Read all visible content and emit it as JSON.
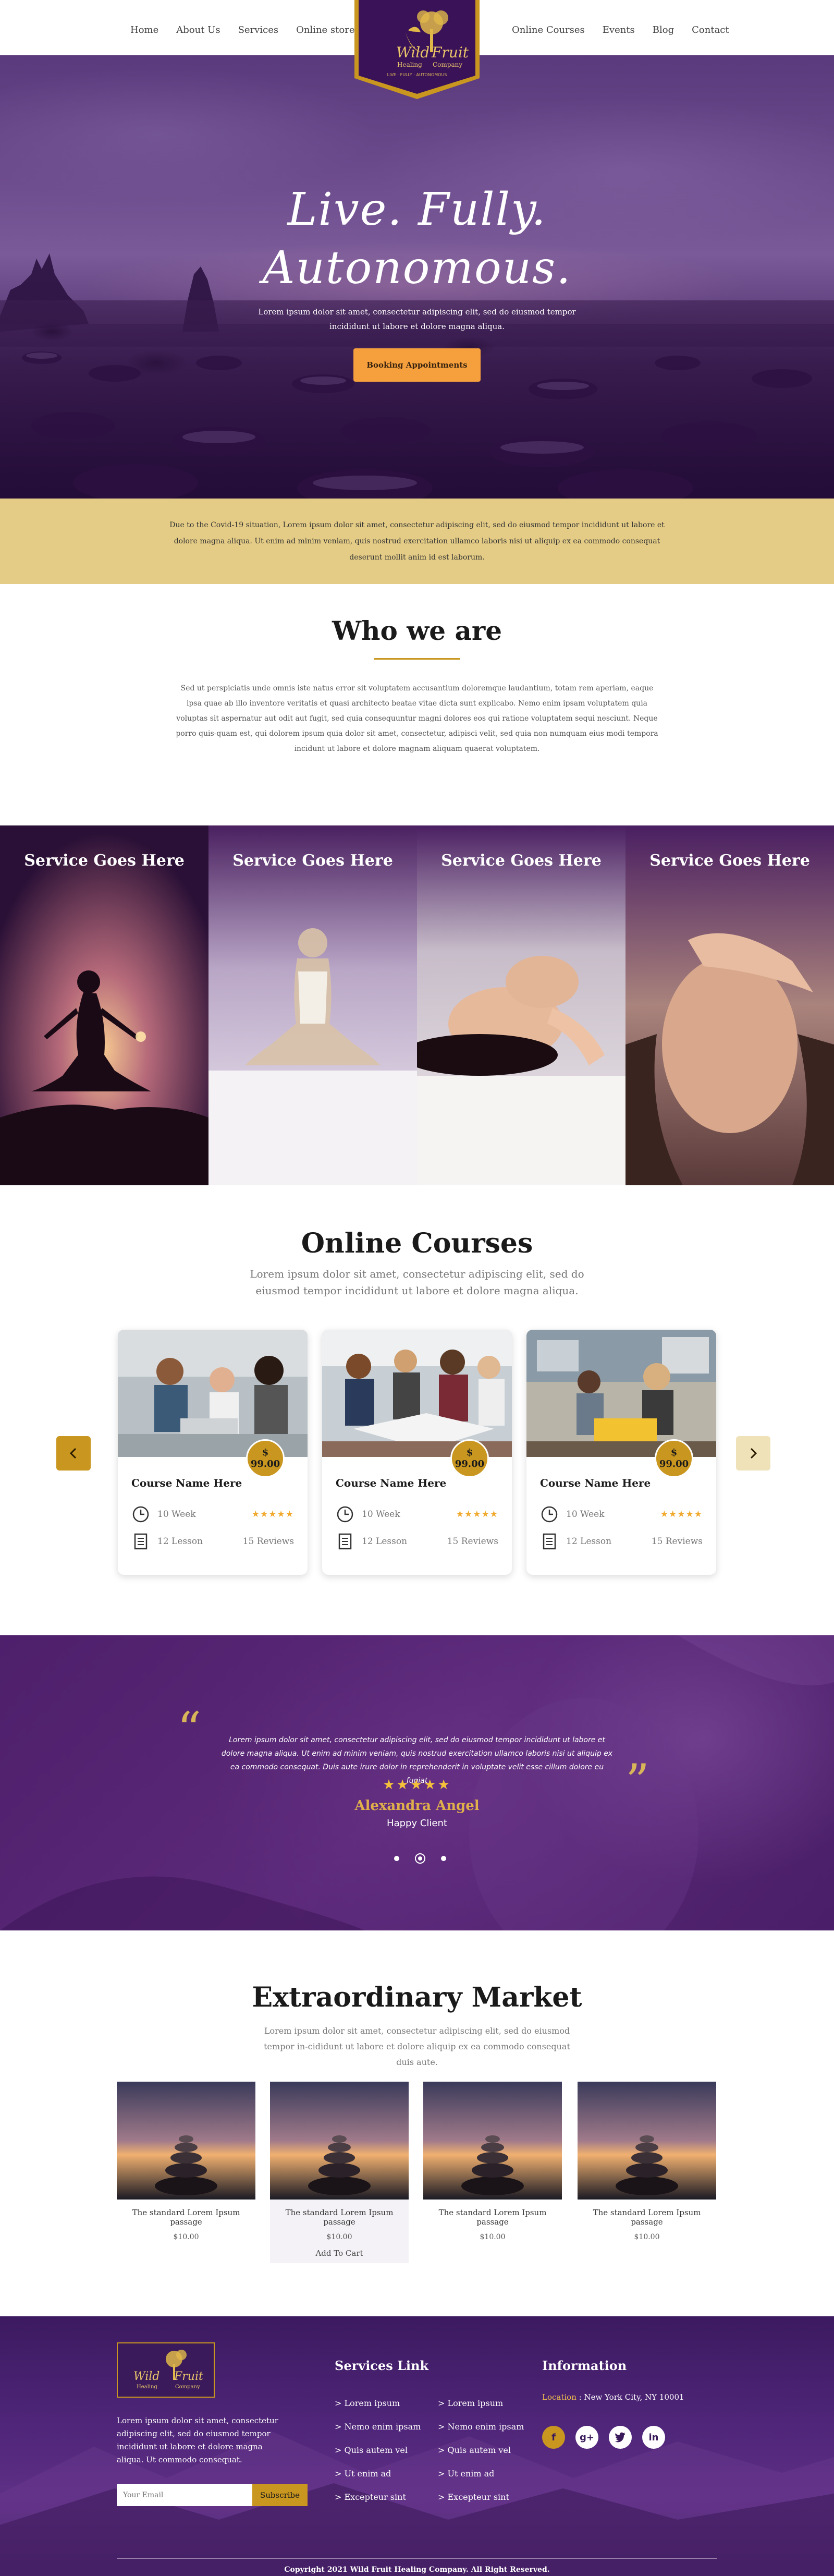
{
  "nav": {
    "left": [
      "Home",
      "About Us",
      "Services",
      "Online store"
    ],
    "right": [
      "Online Courses",
      "Events",
      "Blog",
      "Contact"
    ],
    "logo": {
      "line1": "Wild",
      "line2": "Fruit",
      "line3": "Healing",
      "line4": "Company",
      "tagline": "LIVE · FULLY · AUTONOMOUS"
    }
  },
  "hero": {
    "title_line1": "Live. Fully.",
    "title_line2": "Autonomous.",
    "subtitle": "Lorem ipsum dolor sit amet, consectetur adipiscing elit, sed do eiusmod tempor incididunt ut labore et dolore magna aliqua.",
    "button": "Booking Appointments"
  },
  "notice": {
    "text": "Due to the Covid-19 situation, Lorem ipsum dolor sit amet, consectetur adipiscing elit, sed do eiusmod tempor incididunt ut labore et dolore magna aliqua. Ut enim ad minim veniam, quis nostrud exercitation ullamco laboris nisi ut aliquip ex ea commodo consequat deserunt mollit anim id est laborum."
  },
  "who": {
    "title": "Who we are",
    "text": "Sed ut perspiciatis unde omnis iste natus error sit voluptatem accusantium doloremque laudantium, totam rem aperiam, eaque ipsa quae ab illo inventore veritatis et quasi architecto beatae vitae dicta sunt explicabo. Nemo enim ipsam voluptatem quia voluptas sit aspernatur aut odit aut fugit, sed quia consequuntur magni dolores eos qui ratione voluptatem sequi nesciunt. Neque porro quis-quam est, qui dolorem ipsum quia dolor sit amet, consectetur, adipisci velit, sed quia non numquam eius modi tempora incidunt ut labore et dolore magnam aliquam quaerat voluptatem."
  },
  "services": [
    {
      "label": "Service Goes Here"
    },
    {
      "label": "Service Goes Here"
    },
    {
      "label": "Service Goes Here"
    },
    {
      "label": "Service Goes Here"
    }
  ],
  "courses": {
    "title": "Online Courses",
    "subtitle": "Lorem ipsum dolor sit amet, consectetur adipiscing elit, sed do eiusmod tempor incididunt ut labore et dolore magna aliqua.",
    "items": [
      {
        "name": "Course Name Here",
        "price_symbol": "$",
        "price": "99.00",
        "duration": "10 Week",
        "lessons": "12 Lesson",
        "reviews": "15 Reviews",
        "stars": "★★★★★"
      },
      {
        "name": "Course Name Here",
        "price_symbol": "$",
        "price": "99.00",
        "duration": "10 Week",
        "lessons": "12 Lesson",
        "reviews": "15 Reviews",
        "stars": "★★★★★"
      },
      {
        "name": "Course Name Here",
        "price_symbol": "$",
        "price": "99.00",
        "duration": "10 Week",
        "lessons": "12 Lesson",
        "reviews": "15 Reviews",
        "stars": "★★★★★"
      }
    ]
  },
  "testimonial": {
    "text": "Lorem ipsum dolor sit amet, consectetur adipiscing elit, sed do eiusmod tempor incididunt ut labore et dolore magna aliqua. Ut enim ad minim veniam, quis nostrud exercitation ullamco laboris nisi ut aliquip ex ea commodo consequat. Duis aute irure dolor in reprehenderit in voluptate velit esse cillum dolore eu fugiat",
    "stars": "★★★★★",
    "name": "Alexandra Angel",
    "role": "Happy Client",
    "open_quote": "“",
    "close_quote": "”"
  },
  "market": {
    "title": "Extraordinary Market",
    "subtitle": "Lorem ipsum dolor sit amet, consectetur adipiscing elit, sed do eiusmod tempor in-cididunt ut labore et dolore aliquip ex ea commodo consequat duis aute.",
    "products": [
      {
        "name": "The standard Lorem Ipsum passage",
        "price": "$10.00"
      },
      {
        "name": "The standard Lorem Ipsum passage",
        "price": "$10.00",
        "cart": "Add To Cart"
      },
      {
        "name": "The standard Lorem Ipsum passage",
        "price": "$10.00"
      },
      {
        "name": "The standard Lorem Ipsum passage",
        "price": "$10.00"
      }
    ]
  },
  "footer": {
    "about": "Lorem ipsum dolor sit amet, consectetur adipiscing elit, sed do eiusmod tempor incididunt ut labore et dolore magna aliqua. Ut commodo consequat.",
    "email_placeholder": "Your Email",
    "subscribe": "Subscribe",
    "services_title": "Services Link",
    "links_col1": [
      "> Lorem ipsum",
      "> Nemo enim ipsam",
      "> Quis autem vel",
      "> Ut enim ad",
      "> Excepteur sint"
    ],
    "links_col2": [
      "> Lorem ipsum",
      "> Nemo enim ipsam",
      "> Quis autem vel",
      "> Ut enim ad",
      "> Excepteur sint"
    ],
    "info_title": "Information",
    "location_label": "Location",
    "location_value": " : New York City, NY 10001",
    "social": [
      "f",
      "g+",
      "t",
      "in"
    ],
    "copyright": "Copyright 2021 Wild Fruit Healing Company. All Right Reserved."
  },
  "colors": {
    "gold": "#c9961f",
    "purple": "#4e1f6b",
    "orange": "#f5a03c",
    "notice": "#e4cc86"
  }
}
